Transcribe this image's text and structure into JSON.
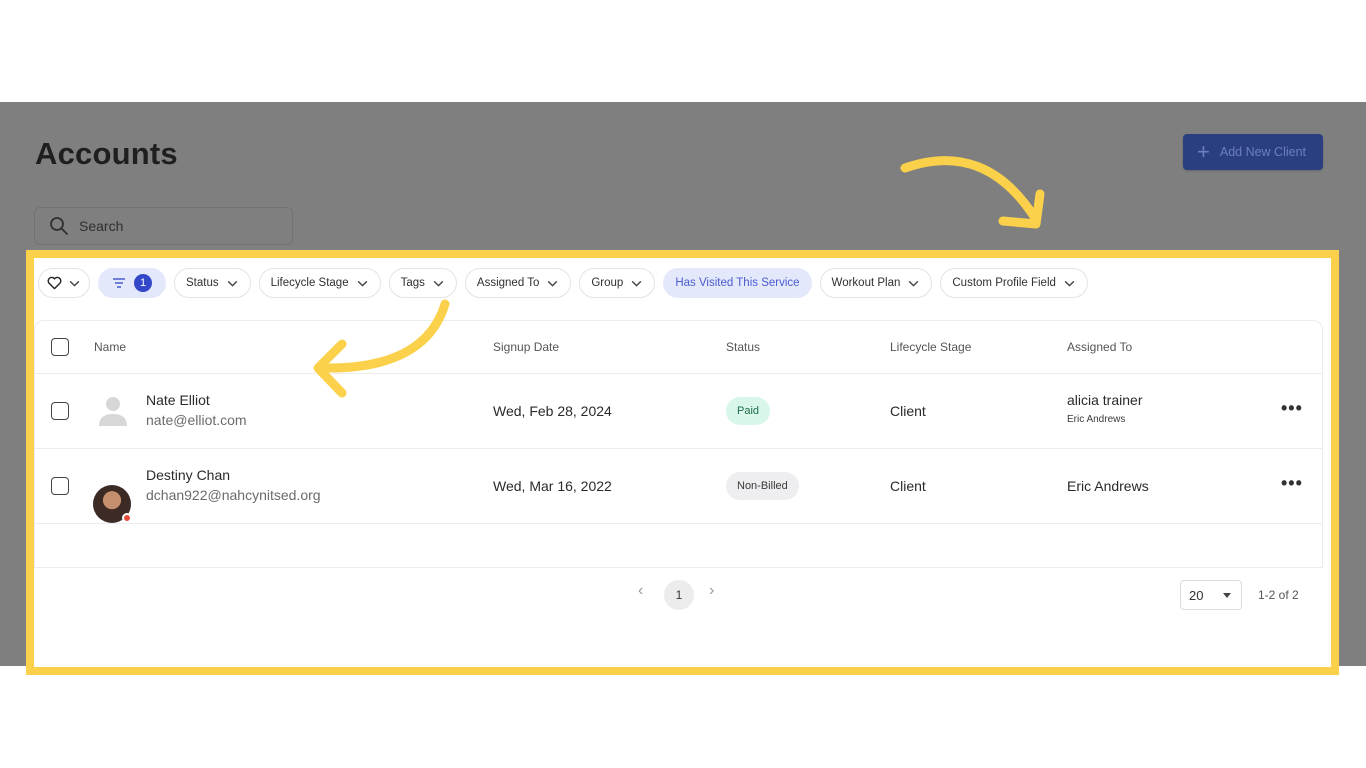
{
  "header": {
    "title": "Accounts",
    "add_button_label": "Add New Client"
  },
  "search": {
    "placeholder": "Search"
  },
  "filters": {
    "active_count": "1",
    "chips": [
      {
        "label": "Status"
      },
      {
        "label": "Lifecycle Stage"
      },
      {
        "label": "Tags"
      },
      {
        "label": "Assigned To"
      },
      {
        "label": "Group"
      },
      {
        "label": "Has Visited This Service"
      },
      {
        "label": "Workout Plan"
      },
      {
        "label": "Custom Profile Field"
      }
    ]
  },
  "table": {
    "columns": {
      "name": "Name",
      "signup": "Signup Date",
      "status": "Status",
      "stage": "Lifecycle Stage",
      "assigned": "Assigned To"
    },
    "rows": [
      {
        "name": "Nate Elliot",
        "email": "nate@elliot.com",
        "signup": "Wed, Feb 28, 2024",
        "status": "Paid",
        "stage": "Client",
        "assigned": "alicia trainer",
        "assigned_sub": "Eric Andrews"
      },
      {
        "name": "Destiny Chan",
        "email": "dchan922@nahcynitsed.org",
        "signup": "Wed, Mar 16, 2022",
        "status": "Non-Billed",
        "stage": "Client",
        "assigned": "Eric Andrews"
      }
    ]
  },
  "pagination": {
    "current_page": "1",
    "per_page": "20",
    "range": "1-2 of 2"
  },
  "colors": {
    "highlight": "#fbd14b",
    "accent": "#3347c9",
    "paid_bg": "#d8f7ea"
  }
}
